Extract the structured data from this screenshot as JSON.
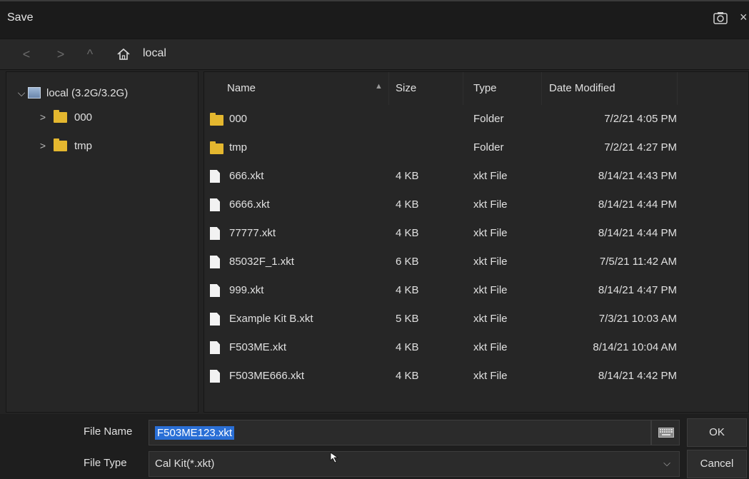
{
  "window": {
    "title": "Save",
    "close_glyph": "×",
    "screenshot_icon": "camera-icon"
  },
  "nav": {
    "back_glyph": "<",
    "forward_glyph": ">",
    "up_glyph": "^",
    "path": "local",
    "home_icon": "home-icon"
  },
  "tree": {
    "root": {
      "label": "local  (3.2G/3.2G)",
      "icon": "drive-icon",
      "expanded": true
    },
    "children": [
      {
        "label": "000",
        "icon": "folder-icon"
      },
      {
        "label": "tmp",
        "icon": "folder-icon"
      }
    ]
  },
  "list": {
    "headers": {
      "name": "Name",
      "size": "Size",
      "type": "Type",
      "date": "Date Modified"
    },
    "sort_glyph": "▲",
    "rows": [
      {
        "name": "000",
        "size": "",
        "type": "Folder",
        "date": "7/2/21 4:05 PM",
        "icon": "folder-icon"
      },
      {
        "name": "tmp",
        "size": "",
        "type": "Folder",
        "date": "7/2/21 4:27 PM",
        "icon": "folder-icon"
      },
      {
        "name": "666.xkt",
        "size": "4 KB",
        "type": "xkt File",
        "date": "8/14/21 4:43 PM",
        "icon": "file-icon"
      },
      {
        "name": "6666.xkt",
        "size": "4 KB",
        "type": "xkt File",
        "date": "8/14/21 4:44 PM",
        "icon": "file-icon"
      },
      {
        "name": "77777.xkt",
        "size": "4 KB",
        "type": "xkt File",
        "date": "8/14/21 4:44 PM",
        "icon": "file-icon"
      },
      {
        "name": "85032F_1.xkt",
        "size": "6 KB",
        "type": "xkt File",
        "date": "7/5/21 11:42 AM",
        "icon": "file-icon"
      },
      {
        "name": "999.xkt",
        "size": "4 KB",
        "type": "xkt File",
        "date": "8/14/21 4:47 PM",
        "icon": "file-icon"
      },
      {
        "name": "Example Kit B.xkt",
        "size": "5 KB",
        "type": "xkt File",
        "date": "7/3/21 10:03 AM",
        "icon": "file-icon"
      },
      {
        "name": "F503ME.xkt",
        "size": "4 KB",
        "type": "xkt File",
        "date": "8/14/21 10:04 AM",
        "icon": "file-icon"
      },
      {
        "name": "F503ME666.xkt",
        "size": "4 KB",
        "type": "xkt File",
        "date": "8/14/21 4:42 PM",
        "icon": "file-icon"
      }
    ]
  },
  "form": {
    "file_name_label": "File Name",
    "file_name_value": "F503ME123.xkt",
    "file_type_label": "File Type",
    "file_type_value": "Cal Kit(*.xkt)",
    "ok_label": "OK",
    "cancel_label": "Cancel",
    "keyboard_icon": "keyboard-icon",
    "dropdown_glyph": "⌵"
  },
  "colors": {
    "background": "#232323",
    "folder": "#e4b72f",
    "selection": "#2a6fd6"
  }
}
